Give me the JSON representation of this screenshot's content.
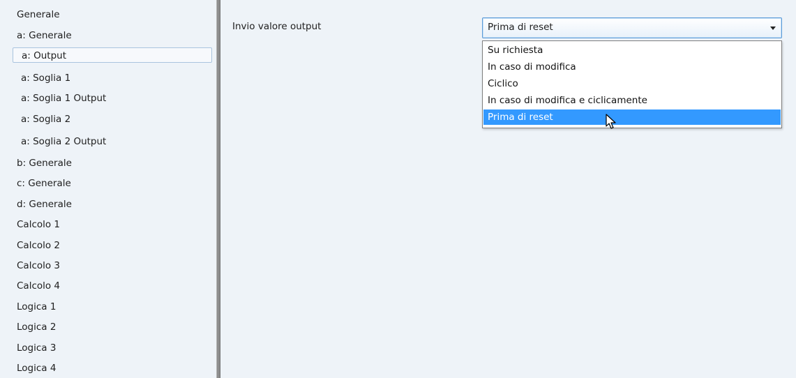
{
  "sidebar": {
    "items": [
      {
        "label": "Generale"
      },
      {
        "label": "a: Generale"
      },
      {
        "label": "a: Output"
      },
      {
        "label": "a: Soglia 1"
      },
      {
        "label": "a: Soglia 1 Output"
      },
      {
        "label": "a: Soglia 2"
      },
      {
        "label": "a: Soglia 2 Output"
      },
      {
        "label": "b: Generale"
      },
      {
        "label": "c: Generale"
      },
      {
        "label": "d: Generale"
      },
      {
        "label": "Calcolo 1"
      },
      {
        "label": "Calcolo 2"
      },
      {
        "label": "Calcolo 3"
      },
      {
        "label": "Calcolo 4"
      },
      {
        "label": "Logica 1"
      },
      {
        "label": "Logica 2"
      },
      {
        "label": "Logica 3"
      },
      {
        "label": "Logica 4"
      }
    ],
    "selected": "a: Output"
  },
  "main": {
    "parameter_label": "Invio valore output",
    "combo": {
      "value": "Prima di reset",
      "options": [
        "Su richiesta",
        "In caso di modifica",
        "Ciclico",
        "In caso di modifica e ciclicamente",
        "Prima di reset"
      ],
      "highlighted": "Prima di reset"
    }
  },
  "colors": {
    "background": "#eef3f8",
    "highlight": "#3399ff",
    "combo_border": "#5b9bd8",
    "splitter": "#8e8e8e"
  }
}
